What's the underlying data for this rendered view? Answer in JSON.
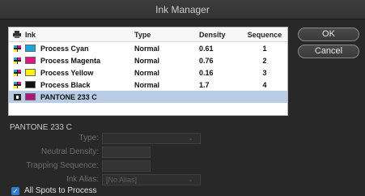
{
  "window": {
    "title": "Ink Manager"
  },
  "table": {
    "headers": {
      "icon": "",
      "ink": "Ink",
      "type": "Type",
      "density": "Density",
      "sequence": "Sequence"
    },
    "rows": [
      {
        "name": "Process Cyan",
        "type": "Normal",
        "density": "0.61",
        "sequence": "1",
        "color": "#1aa7e0",
        "kind": "process"
      },
      {
        "name": "Process Magenta",
        "type": "Normal",
        "density": "0.76",
        "sequence": "2",
        "color": "#e2147f",
        "kind": "process"
      },
      {
        "name": "Process Yellow",
        "type": "Normal",
        "density": "0.16",
        "sequence": "3",
        "color": "#fff200",
        "kind": "process"
      },
      {
        "name": "Process Black",
        "type": "Normal",
        "density": "1.7",
        "sequence": "4",
        "color": "#111111",
        "kind": "process"
      },
      {
        "name": "PANTONE 233 C",
        "type": "",
        "density": "",
        "sequence": "",
        "color": "#b3137a",
        "kind": "spot",
        "selected": true
      }
    ]
  },
  "buttons": {
    "ok": "OK",
    "cancel": "Cancel"
  },
  "details": {
    "title": "PANTONE 233 C",
    "type_label": "Type:",
    "type_value": "",
    "neutral_density_label": "Neutral Density:",
    "neutral_density_value": "",
    "trapping_sequence_label": "Trapping Sequence:",
    "trapping_sequence_value": "",
    "ink_alias_label": "Ink Alias:",
    "ink_alias_value": "[No Alias]"
  },
  "all_spots": {
    "label": "All Spots to Process",
    "checked": true
  },
  "icons": {
    "header_icon": "printer-icon",
    "process_icon": "process-ink-icon",
    "spot_icon": "spot-ink-icon",
    "chevron": "chevron-down-icon",
    "check": "checkmark-icon"
  }
}
